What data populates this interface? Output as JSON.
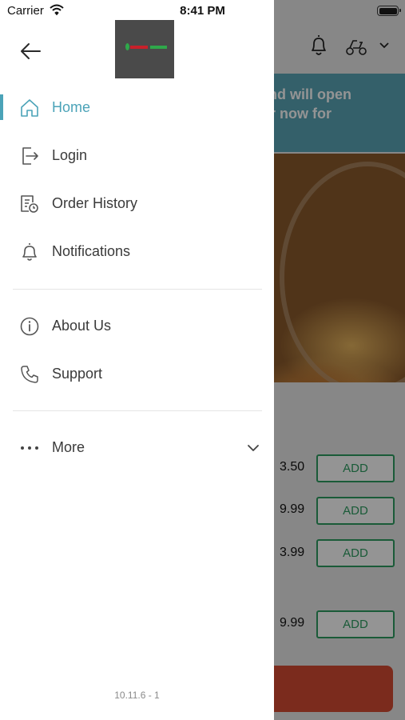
{
  "status_bar": {
    "carrier": "Carrier",
    "time": "8:41 PM",
    "battery_level": 1.0
  },
  "drawer": {
    "menu": [
      {
        "id": "home",
        "label": "Home",
        "icon": "home-icon",
        "active": true
      },
      {
        "id": "login",
        "label": "Login",
        "icon": "login-icon",
        "active": false
      },
      {
        "id": "order-history",
        "label": "Order History",
        "icon": "order-history-icon",
        "active": false
      },
      {
        "id": "notifications",
        "label": "Notifications",
        "icon": "bell-icon",
        "active": false
      }
    ],
    "secondary_menu": [
      {
        "id": "about-us",
        "label": "About Us",
        "icon": "info-icon"
      },
      {
        "id": "support",
        "label": "Support",
        "icon": "phone-icon"
      }
    ],
    "more": {
      "label": "More",
      "icon": "more-dots-icon",
      "expand_icon": "chevron-down-icon"
    },
    "version": "10.11.6 - 1"
  },
  "background": {
    "banner_lines": [
      "d and will open",
      "rder now for"
    ],
    "items": [
      {
        "price": "3.50",
        "button": "ADD"
      },
      {
        "price": "9.99",
        "button": "ADD"
      },
      {
        "price": "3.99",
        "button": "ADD"
      },
      {
        "price": "9.99",
        "button": "ADD"
      }
    ]
  },
  "colors": {
    "accent": "#4ba3b8",
    "banner": "#5aa6b7",
    "add_button": "#2e9e61",
    "checkout_button": "#d44a32",
    "text": "#3a3a3a"
  }
}
